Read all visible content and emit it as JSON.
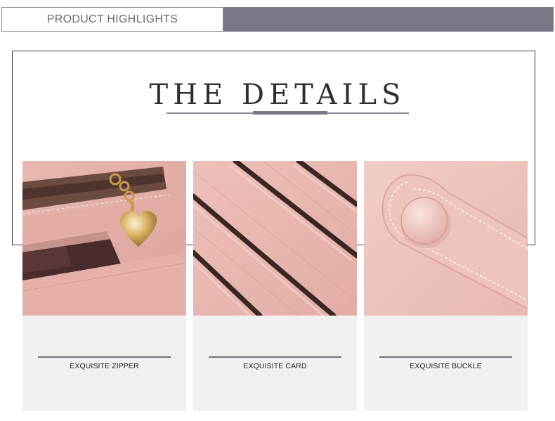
{
  "banner": {
    "label": "PRODUCT HIGHLIGHTS"
  },
  "details": {
    "title": "THE DETAILS"
  },
  "cards": [
    {
      "caption": "EXQUISITE ZIPPER",
      "image": "zipper-closeup"
    },
    {
      "caption": "EXQUISITE CARD",
      "image": "card-slots-closeup"
    },
    {
      "caption": "EXQUISITE BUCKLE",
      "image": "snap-button-closeup"
    }
  ],
  "colors": {
    "banner_bar": "#7a7887",
    "leather_pink": "#e6b4ae",
    "gold_hardware": "#d9b062"
  }
}
